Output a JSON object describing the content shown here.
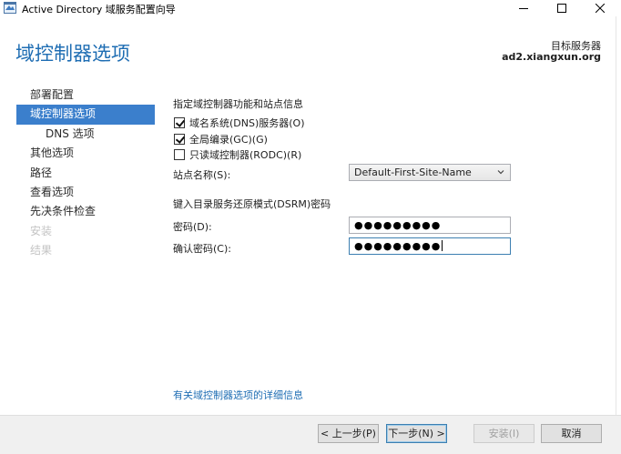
{
  "window": {
    "title": "Active Directory 域服务配置向导",
    "app_icon": "ad-wizard-icon"
  },
  "header": {
    "page_title": "域控制器选项",
    "target_label": "目标服务器",
    "target_server": "ad2.xiangxun.org"
  },
  "nav": {
    "items": [
      {
        "label": "部署配置",
        "state": "normal"
      },
      {
        "label": "域控制器选项",
        "state": "selected"
      },
      {
        "label": "DNS 选项",
        "state": "normal",
        "sub": true
      },
      {
        "label": "其他选项",
        "state": "normal"
      },
      {
        "label": "路径",
        "state": "normal"
      },
      {
        "label": "查看选项",
        "state": "normal"
      },
      {
        "label": "先决条件检查",
        "state": "normal"
      },
      {
        "label": "安装",
        "state": "disabled"
      },
      {
        "label": "结果",
        "state": "disabled"
      }
    ]
  },
  "main": {
    "capabilities_heading": "指定域控制器功能和站点信息",
    "checkboxes": [
      {
        "label": "域名系统(DNS)服务器(O)",
        "checked": true
      },
      {
        "label": "全局编录(GC)(G)",
        "checked": true
      },
      {
        "label": "只读域控制器(RODC)(R)",
        "checked": false
      }
    ],
    "site_label": "站点名称(S):",
    "site_value": "Default-First-Site-Name",
    "dsrm_heading": "键入目录服务还原模式(DSRM)密码",
    "password_label": "密码(D):",
    "password_value": "●●●●●●●●●",
    "confirm_label": "确认密码(C):",
    "confirm_value": "●●●●●●●●●",
    "help_link": "有关域控制器选项的详细信息"
  },
  "footer": {
    "prev_label": "< 上一步(P)",
    "next_label": "下一步(N) >",
    "install_label": "安装(I)",
    "cancel_label": "取消"
  },
  "colors": {
    "accent": "#1e6db3",
    "selected_nav": "#3b7fcc",
    "disabled_text": "#c4c4c4"
  }
}
